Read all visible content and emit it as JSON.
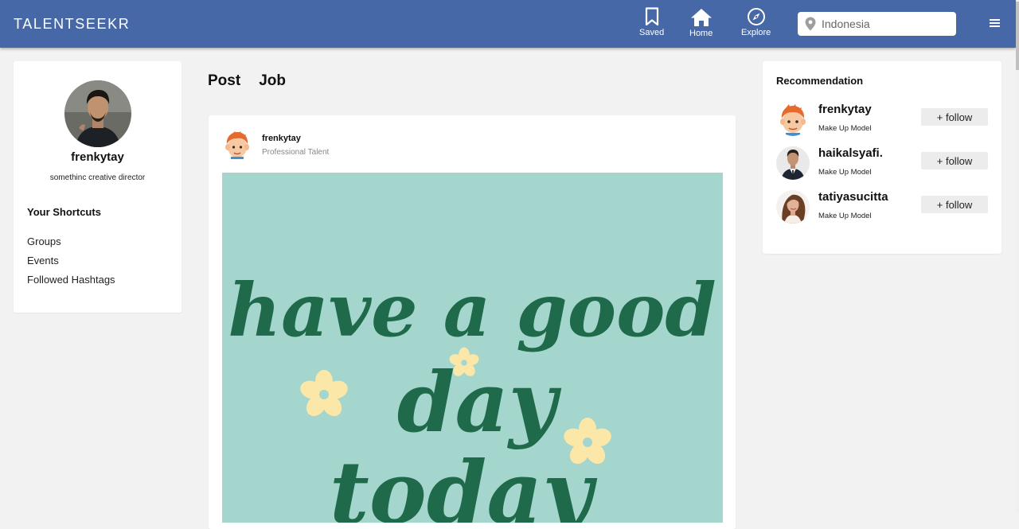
{
  "header": {
    "brand": "TALENTSEEKR",
    "nav": [
      {
        "label": "Saved",
        "icon": "bookmark-icon"
      },
      {
        "label": "Home",
        "icon": "home-icon"
      },
      {
        "label": "Explore",
        "icon": "compass-icon"
      }
    ],
    "search": {
      "placeholder": "Indonesia",
      "icon": "location-pin-icon"
    },
    "menu_icon": "hamburger-menu-icon"
  },
  "profile": {
    "name": "frenkytay",
    "role": "somethinc creative director",
    "shortcuts_title": "Your Shortcuts",
    "shortcuts": [
      "Groups",
      "Events",
      "Followed Hashtags"
    ]
  },
  "tabs": [
    "Post",
    "Job"
  ],
  "post": {
    "user": "frenkytay",
    "role": "Professional Talent",
    "image_text": [
      "have a good",
      "day",
      "today"
    ]
  },
  "recommendation": {
    "title": "Recommendation",
    "people": [
      {
        "name": "frenkytay",
        "role": "Make Up Model",
        "button": "+ follow"
      },
      {
        "name": "haikalsyafi.",
        "role": "Make Up Model",
        "button": "+ follow"
      },
      {
        "name": "tatiyasucitta",
        "role": "Make Up Model",
        "button": "+ follow"
      }
    ]
  },
  "colors": {
    "header": "#4768a6",
    "post_image_bg": "#a5d6ce",
    "lettering": "#1f6a4a",
    "flower": "#fbe7a8"
  }
}
